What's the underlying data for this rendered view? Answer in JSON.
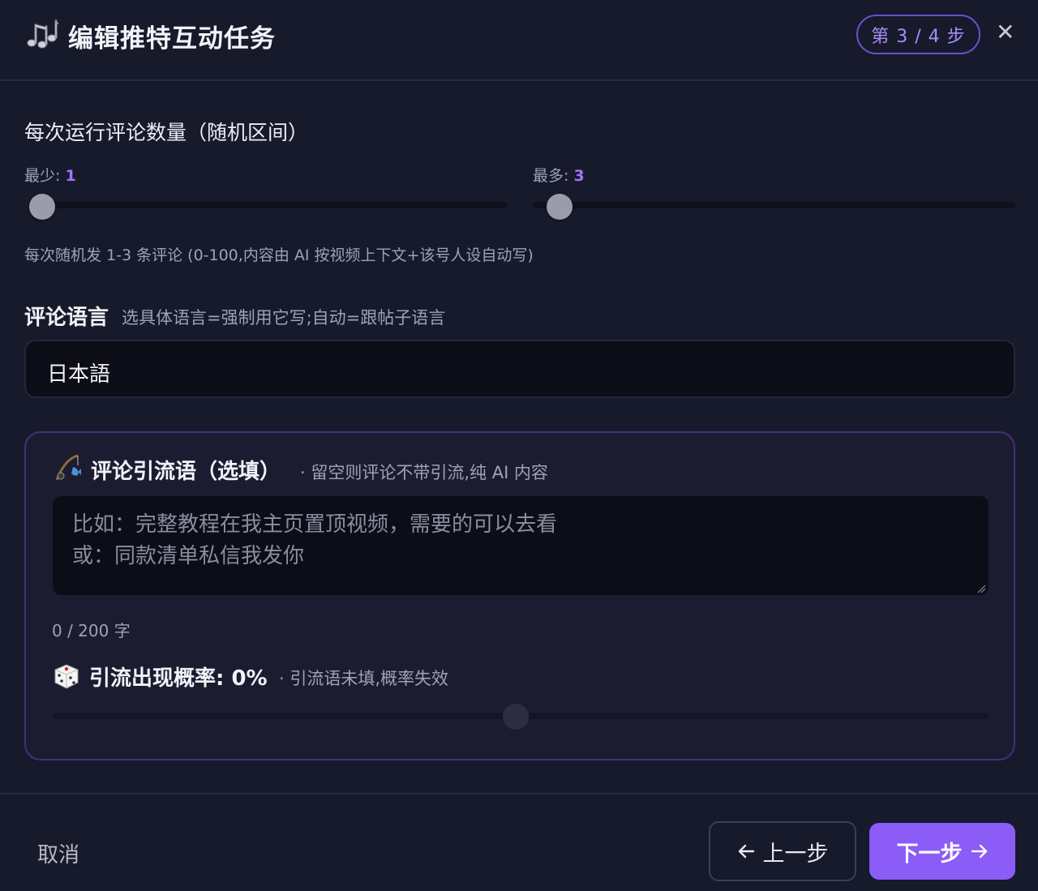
{
  "header": {
    "title": "编辑推特互动任务",
    "step_badge": "第 3 / 4 步",
    "close_label": "✕"
  },
  "comment_count": {
    "section_title": "每次运行评论数量（随机区间）",
    "min_label": "最少:",
    "min_value": "1",
    "max_label": "最多:",
    "max_value": "3",
    "min_slider_value": 1,
    "max_slider_value": 3,
    "hint": "每次随机发 1-3 条评论 (0-100,内容由 AI 按视频上下文+该号人设自动写)"
  },
  "language": {
    "title": "评论语言",
    "subtitle": "选具体语言=强制用它写;自动=跟帖子语言",
    "selected": "日本語"
  },
  "lead_card": {
    "title": "评论引流语（选填）",
    "subtitle": "· 留空则评论不带引流,纯 AI 内容",
    "placeholder": "比如：完整教程在我主页置顶视频，需要的可以去看\n或：同款清单私信我发你",
    "counter": "0 / 200 字",
    "prob_title": "引流出现概率: 0%",
    "prob_sub": "· 引流语未填,概率失效",
    "prob_value": 0
  },
  "footer": {
    "cancel_label": "取消",
    "prev_label": "上一步",
    "next_label": "下一步"
  },
  "colors": {
    "accent": "#8b5cf6",
    "accent_text": "#a274ff",
    "card_border": "#4a2e7a",
    "background": "#161a2b"
  }
}
